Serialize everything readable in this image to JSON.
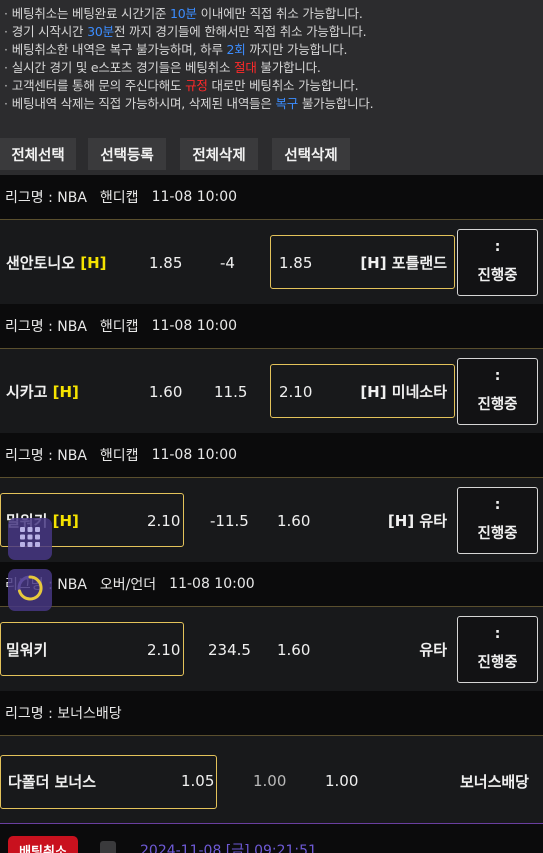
{
  "notice": {
    "lines": [
      {
        "parts": [
          {
            "t": "베팅취소는 베팅완료 시간기준 "
          },
          {
            "t": "10분",
            "c": "blue"
          },
          {
            "t": " 이내에만 직접 취소 가능합니다."
          }
        ]
      },
      {
        "parts": [
          {
            "t": "경기 시작시간 "
          },
          {
            "t": "30분",
            "c": "blue"
          },
          {
            "t": "전 까지 경기들에 한해서만 직접 취소 가능합니다."
          }
        ]
      },
      {
        "parts": [
          {
            "t": "베팅취소한 내역은 복구 불가능하며, 하루 "
          },
          {
            "t": "2회",
            "c": "blue"
          },
          {
            "t": " 까지만 가능합니다."
          }
        ]
      },
      {
        "parts": [
          {
            "t": "실시간 경기 및 e스포츠 경기들은 베팅취소 "
          },
          {
            "t": "절대",
            "c": "red"
          },
          {
            "t": " 불가합니다."
          }
        ]
      },
      {
        "parts": [
          {
            "t": "고객센터를 통해 문의 주신다해도 "
          },
          {
            "t": "규정",
            "c": "red"
          },
          {
            "t": " 대로만 베팅취소 가능합니다."
          }
        ]
      },
      {
        "parts": [
          {
            "t": "베팅내역 삭제는 직접 가능하시며, 삭제된 내역들은 "
          },
          {
            "t": "복구",
            "c": "blue"
          },
          {
            "t": " 불가능합니다."
          }
        ]
      }
    ],
    "bullet": "·"
  },
  "toolbar": {
    "select_all": "전체선택",
    "register_selected": "선택등록",
    "delete_all": "전체삭제",
    "delete_selected": "선택삭제"
  },
  "bets": [
    {
      "league_label": "리그명 : NBA",
      "market": "핸디캡",
      "time": "11-08 10:00",
      "home": "샌안토니오",
      "home_mark": "[H]",
      "home_odds": "1.85",
      "line": "-4",
      "away_odds": "1.85",
      "away": "[H] 포틀랜드",
      "status_top": ":",
      "status": "진행중"
    },
    {
      "league_label": "리그명 : NBA",
      "market": "핸디캡",
      "time": "11-08 10:00",
      "home": "시카고",
      "home_mark": "[H]",
      "home_odds": "1.60",
      "line": "11.5",
      "away_odds": "2.10",
      "away": "[H] 미네소타",
      "status_top": ":",
      "status": "진행중"
    },
    {
      "league_label": "리그명 : NBA",
      "market": "핸디캡",
      "time": "11-08 10:00",
      "home": "밀워키",
      "home_mark": "[H]",
      "home_odds": "2.10",
      "line": "-11.5",
      "away_odds": "1.60",
      "away": "[H] 유타",
      "status_top": ":",
      "status": "진행중"
    },
    {
      "league_label": "리그명 : NBA",
      "market": "오버/언더",
      "time": "11-08 10:00",
      "home": "밀워키",
      "home_mark": "",
      "home_odds": "2.10",
      "line": "234.5",
      "away_odds": "1.60",
      "away": "유타",
      "status_top": ":",
      "status": "진행중"
    },
    {
      "league_label": "리그명 : 보너스배당",
      "market": "",
      "time": "",
      "home": "다폴더 보너스",
      "home_mark": "",
      "home_odds": "1.05",
      "line": "1.00",
      "away_odds": "1.00",
      "away": "보너스배당",
      "status_top": "",
      "status": ""
    }
  ],
  "footer": {
    "cancel_label": "배팅취소",
    "date": "2024-11-08 [금] 09:21:51"
  },
  "floating": {
    "grid_icon": "grid-icon",
    "spinner_icon": "loading-spinner-icon"
  },
  "colors": {
    "accent_blue": "#3c8dff",
    "accent_red": "#ff2a2a",
    "home_mark": "#f5e300",
    "selected_border": "#e3c25a",
    "cancel_button": "#c9111e",
    "date_text": "#6e5ad6"
  }
}
